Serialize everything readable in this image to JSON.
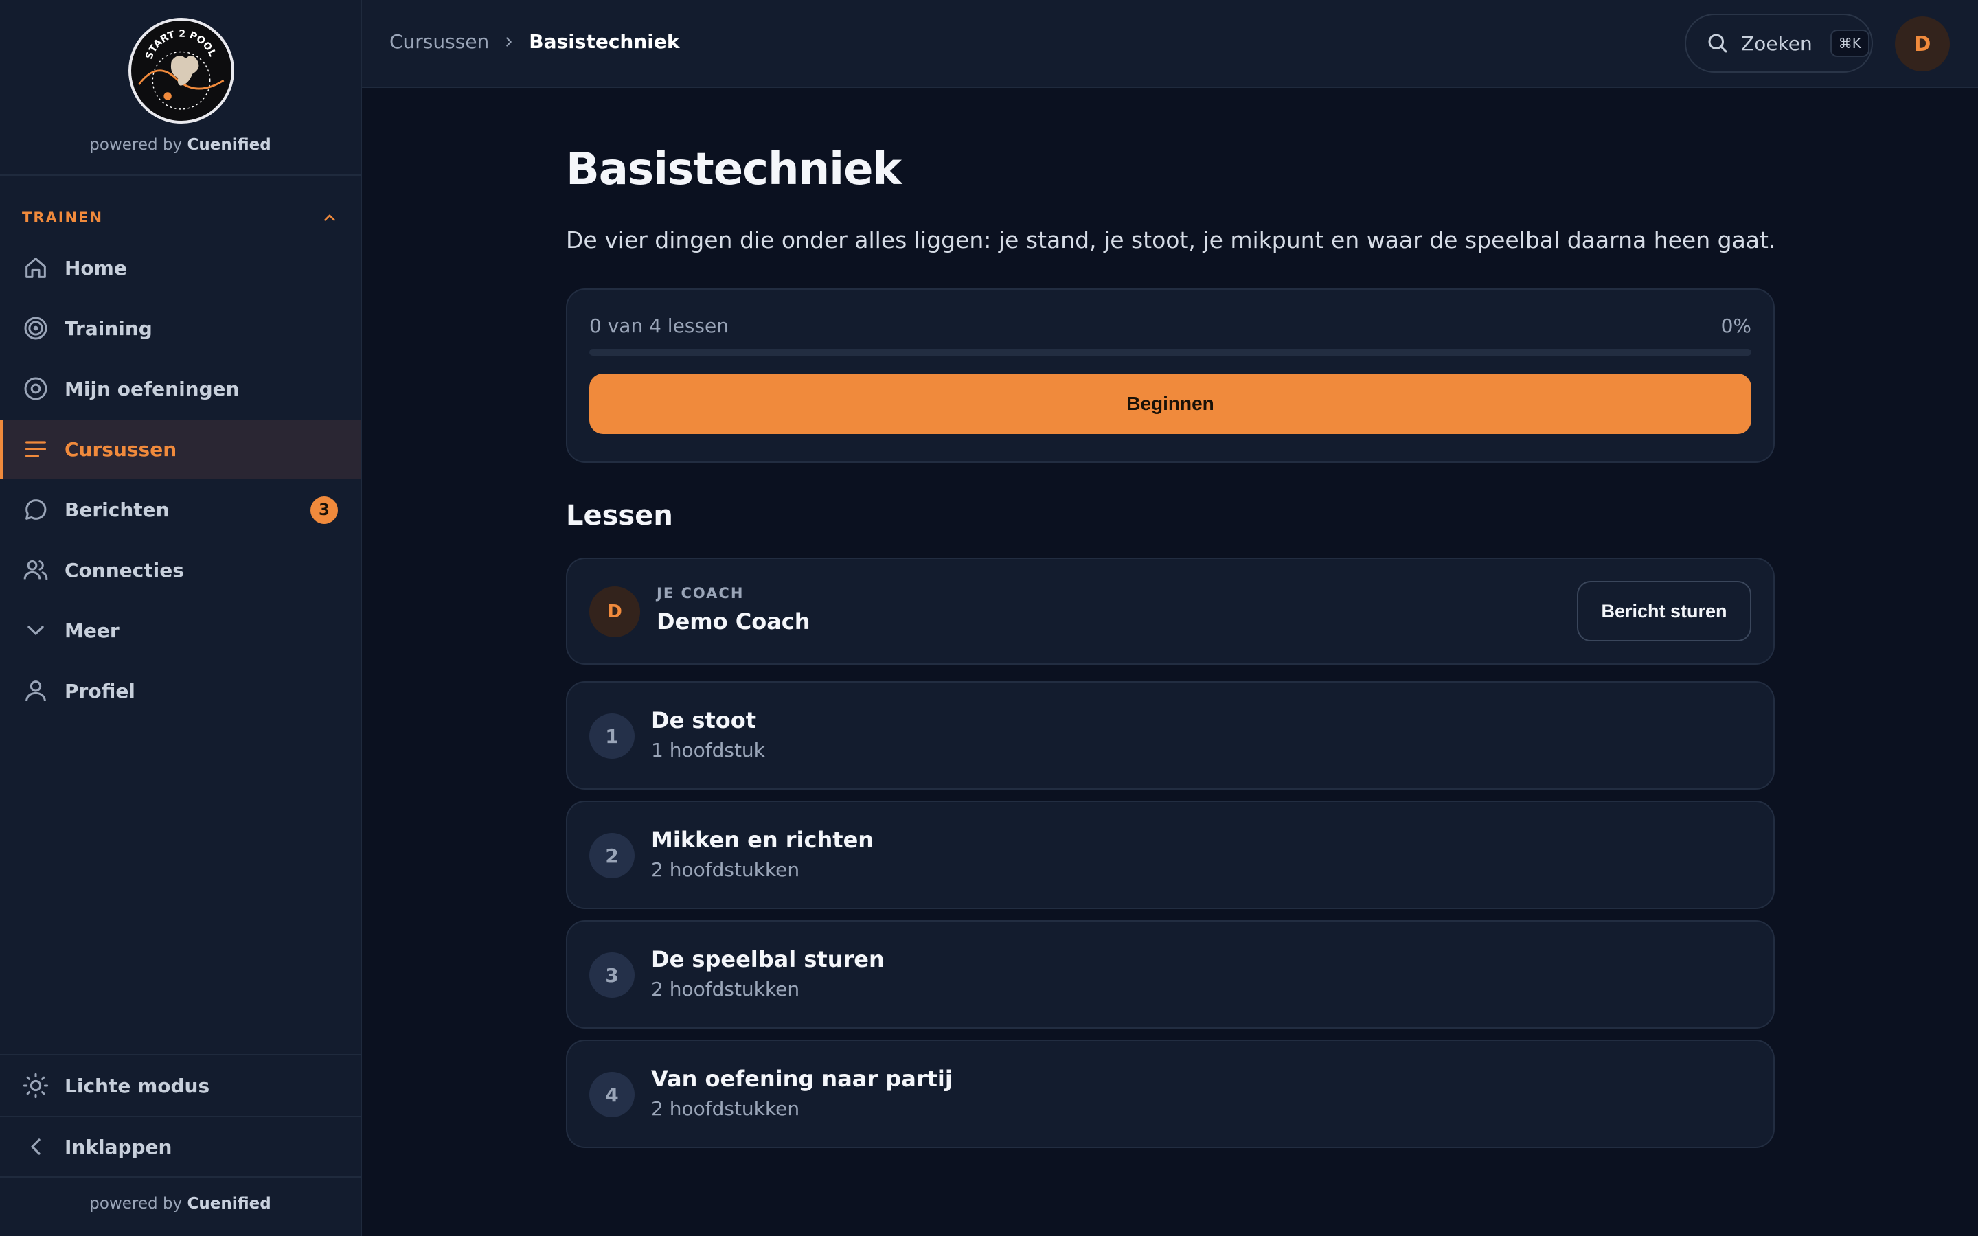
{
  "brand": {
    "logo_text": "START 2 POOL",
    "powered_prefix": "powered by",
    "powered_name": "Cuenified"
  },
  "sidebar": {
    "section_title": "TRAINEN",
    "items": [
      {
        "label": "Home",
        "icon": "home-icon"
      },
      {
        "label": "Training",
        "icon": "target-icon"
      },
      {
        "label": "Mijn oefeningen",
        "icon": "target-small-icon"
      },
      {
        "label": "Cursussen",
        "icon": "list-icon",
        "active": true
      },
      {
        "label": "Berichten",
        "icon": "chat-icon",
        "badge": "3"
      },
      {
        "label": "Connecties",
        "icon": "users-icon"
      },
      {
        "label": "Meer",
        "icon": "chevron-down-icon"
      },
      {
        "label": "Profiel",
        "icon": "user-icon"
      }
    ],
    "theme_toggle": "Lichte modus",
    "collapse": "Inklappen",
    "footer_prefix": "powered by",
    "footer_name": "Cuenified"
  },
  "topbar": {
    "breadcrumb": [
      "Cursussen",
      "Basistechniek"
    ],
    "search_label": "Zoeken",
    "search_shortcut": "⌘K",
    "avatar_initial": "D"
  },
  "course": {
    "title": "Basistechniek",
    "description": "De vier dingen die onder alles liggen: je stand, je stoot, je mikpunt en waar de speelbal daarna heen gaat.",
    "progress_text": "0 van 4 lessen",
    "progress_percent_label": "0%",
    "progress_value": 0,
    "start_button": "Beginnen",
    "lessons_heading": "Lessen"
  },
  "coach": {
    "role": "JE COACH",
    "name": "Demo Coach",
    "initial": "D",
    "message_button": "Bericht sturen"
  },
  "lessons": [
    {
      "number": "1",
      "title": "De stoot",
      "subtitle": "1 hoofdstuk"
    },
    {
      "number": "2",
      "title": "Mikken en richten",
      "subtitle": "2 hoofdstukken"
    },
    {
      "number": "3",
      "title": "De speelbal sturen",
      "subtitle": "2 hoofdstukken"
    },
    {
      "number": "4",
      "title": "Van oefening naar partij",
      "subtitle": "2 hoofdstukken"
    }
  ],
  "colors": {
    "accent": "#f08a3c",
    "background": "#0b1120",
    "surface": "#131c2e",
    "muted_text": "#9aa5b8"
  }
}
